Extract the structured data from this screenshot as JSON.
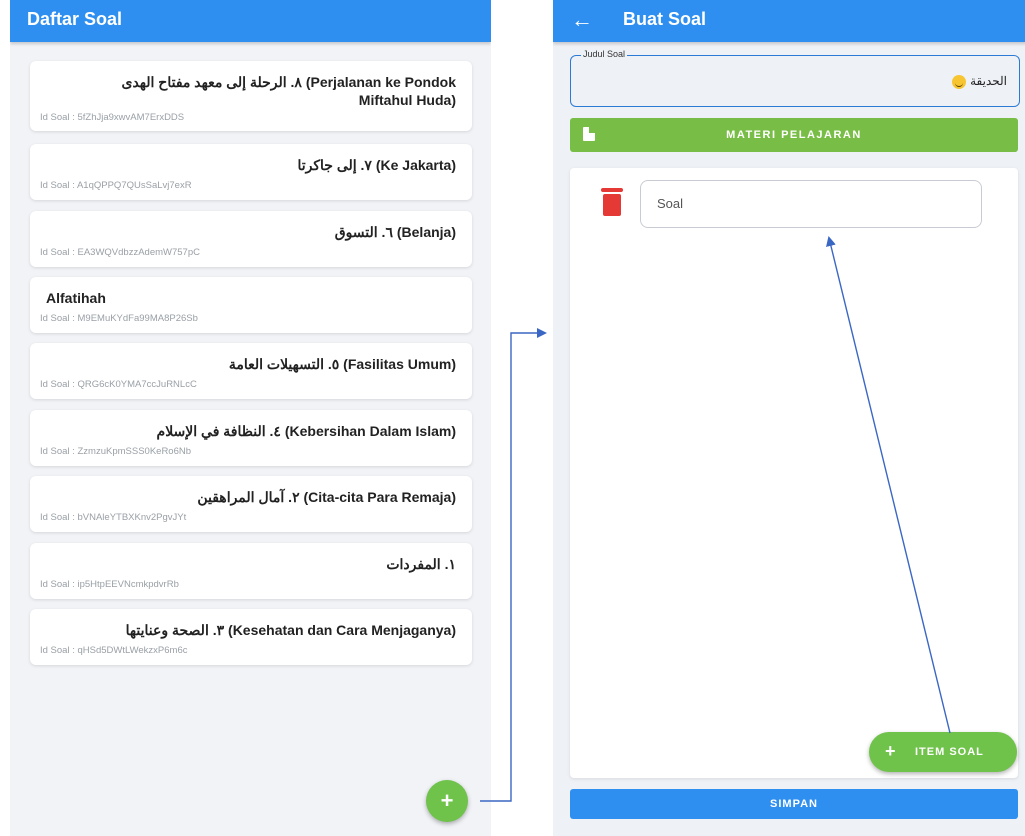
{
  "left_screen": {
    "title": "Daftar Soal",
    "cards": [
      {
        "title_line1": "٨. الرحلة إلى معهد مفتاح الهدى (Perjalanan ke Pondok",
        "title_line2": "Miftahul Huda)",
        "id": "Id Soal : 5fZhJja9xwvAM7ErxDDS"
      },
      {
        "title": "٧. إلى جاكرتا (Ke Jakarta)",
        "id": "Id Soal : A1qQPPQ7QUsSaLvj7exR"
      },
      {
        "title": "٦. التسوق (Belanja)",
        "id": "Id Soal : EA3WQVdbzzAdemW757pC"
      },
      {
        "title": "Alfatihah",
        "id": "Id Soal : M9EMuKYdFa99MA8P26Sb"
      },
      {
        "title": "٥. التسهيلات العامة (Fasilitas Umum)",
        "id": "Id Soal : QRG6cK0YMA7ccJuRNLcC"
      },
      {
        "title": "٤. النظافة في الإسلام (Kebersihan Dalam Islam)",
        "id": "Id Soal : ZzmzuKpmSSS0KeRo6Nb"
      },
      {
        "title": "٢. آمال المراهقين (Cita-cita Para Remaja)",
        "id": "Id Soal : bVNAleYTBXKnv2PgvJYt"
      },
      {
        "title": "١. المفردات",
        "id": "Id Soal : ip5HtpEEVNcmkpdvrRb"
      },
      {
        "title": "٣. الصحة وعنايتها (Kesehatan dan Cara Menjaganya)",
        "id": "Id Soal : qHSd5DWtLWekzxP6m6c"
      }
    ],
    "fab_label": "+"
  },
  "right_screen": {
    "title": "Buat Soal",
    "back_icon": "←",
    "judul_label": "Judul Soal",
    "judul_value": "الحديقة",
    "materi_label": "MATERI PELAJARAN",
    "soal_placeholder": "Soal",
    "item_soal_label": "ITEM SOAL",
    "item_soal_plus": "+",
    "simpan_label": "SIMPAN"
  },
  "colors": {
    "appbar": "#2f8ff0",
    "green": "#78bd45",
    "fab_green": "#6fc24a",
    "delete_red": "#e53935",
    "annotation_arrow": "#3b67c4"
  }
}
